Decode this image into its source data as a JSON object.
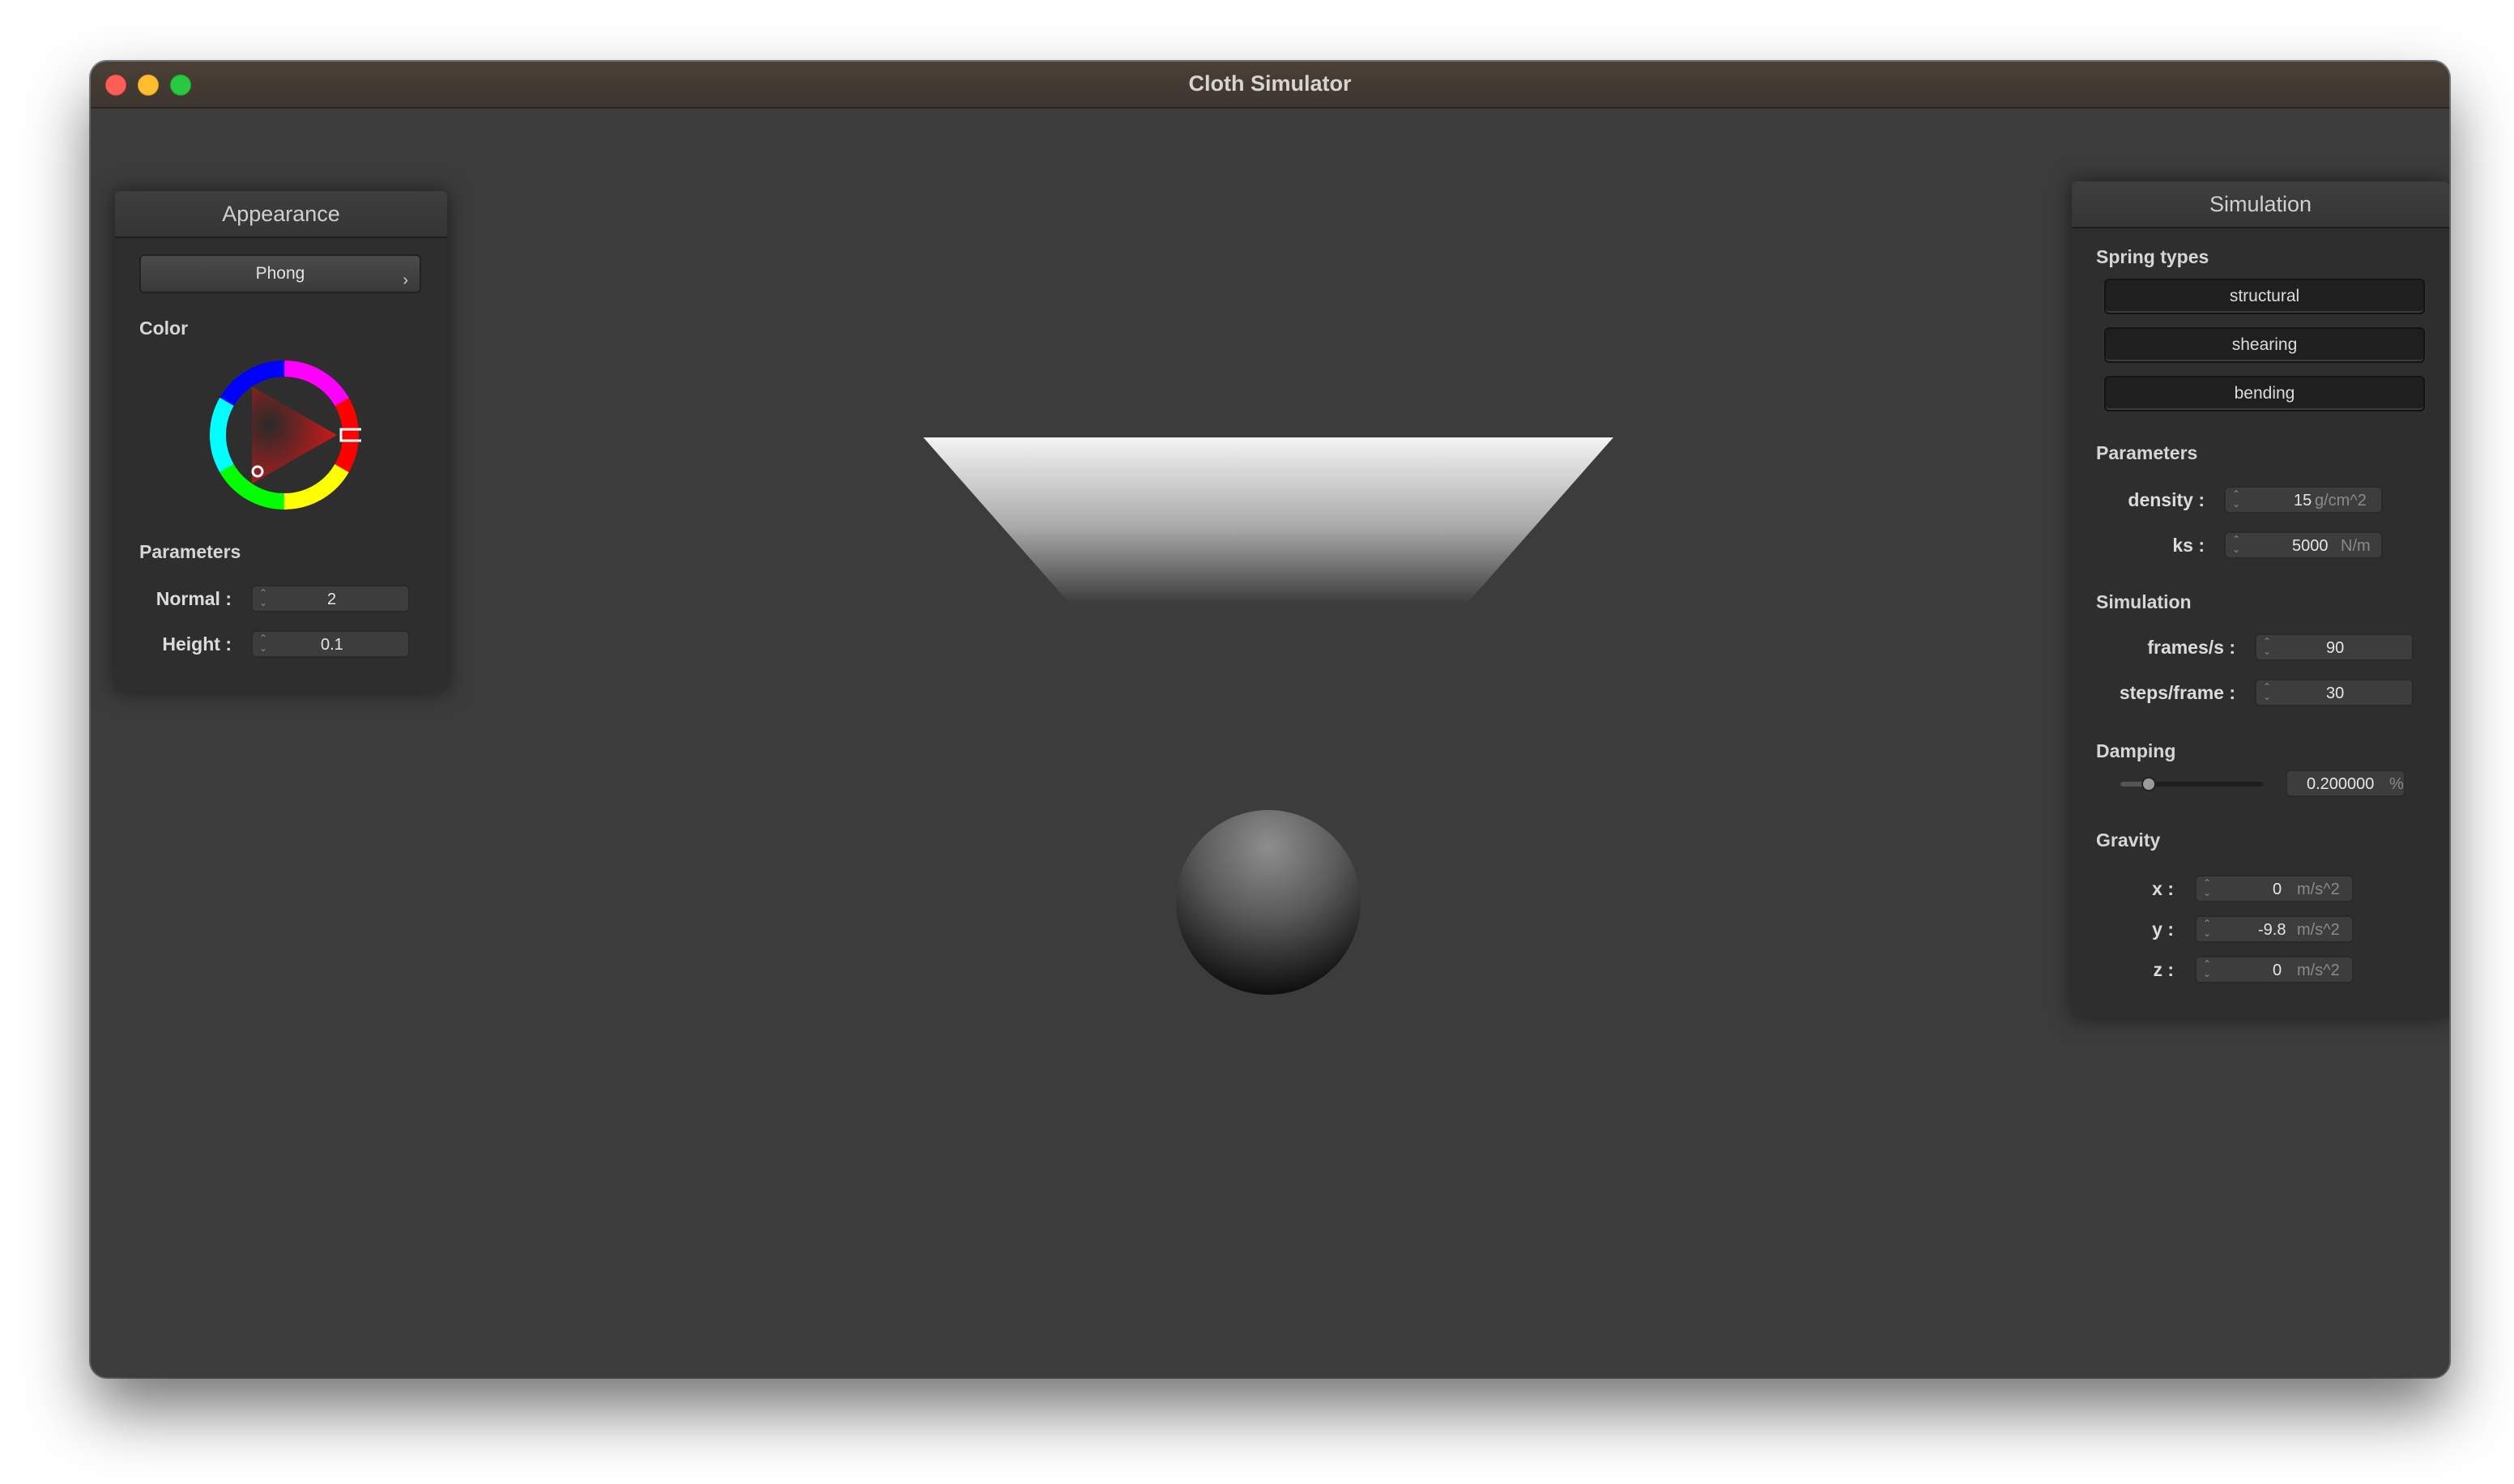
{
  "window": {
    "title": "Cloth Simulator"
  },
  "appearance": {
    "title": "Appearance",
    "shader": "Phong",
    "color_label": "Color",
    "selected_hue_color": "#e02020",
    "params_label": "Parameters",
    "normal": {
      "label": "Normal :",
      "value": "2"
    },
    "height": {
      "label": "Height :",
      "value": "0.1"
    }
  },
  "simulation": {
    "title": "Simulation",
    "spring_types_label": "Spring types",
    "springs": [
      "structural",
      "shearing",
      "bending"
    ],
    "params_label": "Parameters",
    "density": {
      "label": "density :",
      "value": "15",
      "unit": "g/cm^2"
    },
    "ks": {
      "label": "ks :",
      "value": "5000",
      "unit": "N/m"
    },
    "sim_label": "Simulation",
    "fps": {
      "label": "frames/s :",
      "value": "90"
    },
    "steps": {
      "label": "steps/frame :",
      "value": "30"
    },
    "damping_label": "Damping",
    "damping": {
      "value": "0.200000",
      "unit": "%",
      "slider_fraction": 0.2
    },
    "gravity_label": "Gravity",
    "gx": {
      "label": "x :",
      "value": "0",
      "unit": "m/s^2"
    },
    "gy": {
      "label": "y :",
      "value": "-9.8",
      "unit": "m/s^2"
    },
    "gz": {
      "label": "z :",
      "value": "0",
      "unit": "m/s^2"
    }
  }
}
